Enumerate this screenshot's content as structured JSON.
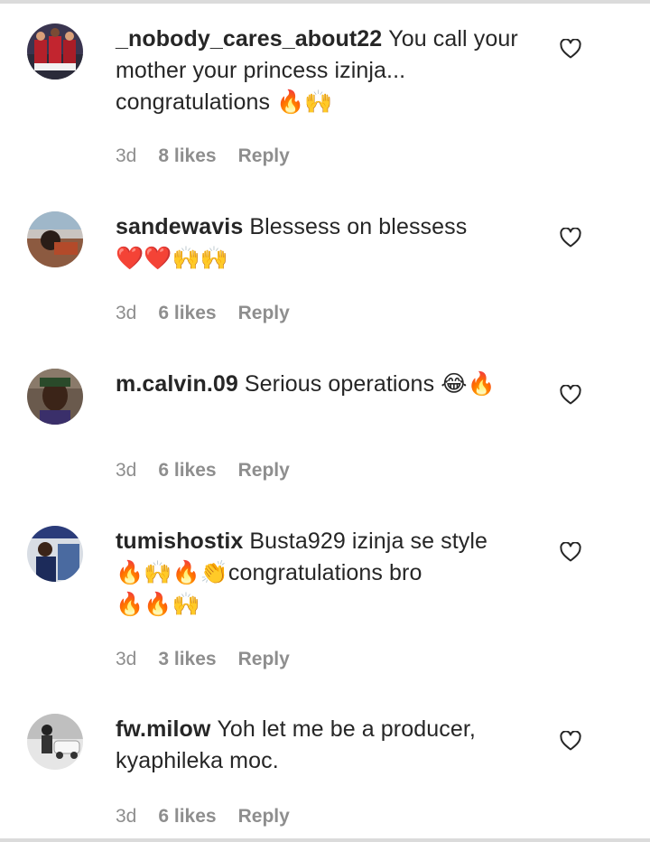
{
  "comments": [
    {
      "username": "_nobody_cares_about22",
      "text": "You call your mother your princess izinja... congratulations",
      "emoji": "🔥🙌",
      "time": "3d",
      "likes": "8 likes",
      "reply": "Reply"
    },
    {
      "username": "sandewavis",
      "text": "Blessess on blessess",
      "emoji": "❤️❤️🙌🙌",
      "time": "3d",
      "likes": "6 likes",
      "reply": "Reply"
    },
    {
      "username": "m.calvin.09",
      "text": "Serious operations",
      "emoji": "😂🔥",
      "time": "3d",
      "likes": "6 likes",
      "reply": "Reply"
    },
    {
      "username": "tumishostix",
      "text": "Busta929 izinja se style",
      "emoji_a": "🔥🙌🔥👏",
      "text_b": "congratulations bro",
      "emoji_b": "🔥🔥🙌",
      "time": "3d",
      "likes": "3 likes",
      "reply": "Reply"
    },
    {
      "username": "fw.milow",
      "text": "Yoh let me be a producer, kyaphileka moc.",
      "time": "3d",
      "likes": "6 likes",
      "reply": "Reply"
    }
  ],
  "colors": {
    "text": "#262626",
    "meta": "#8e8e8e",
    "border": "#dbdbdb"
  },
  "icons": {
    "like": "heart-outline-icon"
  }
}
